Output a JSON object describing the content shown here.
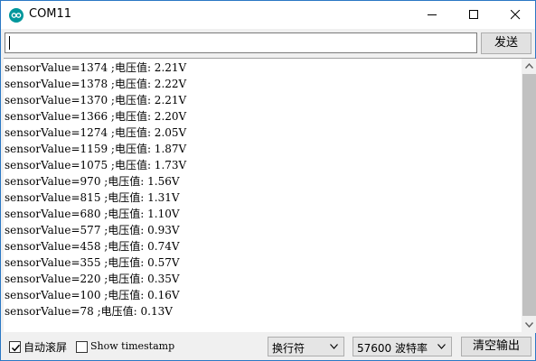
{
  "window": {
    "title": "COM11",
    "app_icon": "arduino-infinity-icon"
  },
  "send_row": {
    "input_value": "",
    "send_label": "发送"
  },
  "output": {
    "lines": [
      "sensorValue=1374 ;电压值: 2.21V",
      "sensorValue=1378 ;电压值: 2.22V",
      "sensorValue=1370 ;电压值: 2.21V",
      "sensorValue=1366 ;电压值: 2.20V",
      "sensorValue=1274 ;电压值: 2.05V",
      "sensorValue=1159 ;电压值: 1.87V",
      "sensorValue=1075 ;电压值: 1.73V",
      "sensorValue=970 ;电压值: 1.56V",
      "sensorValue=815 ;电压值: 1.31V",
      "sensorValue=680 ;电压值: 1.10V",
      "sensorValue=577 ;电压值: 0.93V",
      "sensorValue=458 ;电压值: 0.74V",
      "sensorValue=355 ;电压值: 0.57V",
      "sensorValue=220 ;电压值: 0.35V",
      "sensorValue=100 ;电压值: 0.16V",
      "sensorValue=78 ;电压值: 0.13V"
    ]
  },
  "bottom_bar": {
    "autoscroll_label": "自动滚屏",
    "autoscroll_checked": true,
    "timestamp_label": "Show timestamp",
    "timestamp_checked": false,
    "line_ending": "换行符",
    "baud_rate": "57600 波特率",
    "clear_label": "清空输出"
  },
  "colors": {
    "arduino_teal": "#00979c",
    "window_border": "#2b78c4",
    "scroll_thumb": "#c1c1c1"
  }
}
